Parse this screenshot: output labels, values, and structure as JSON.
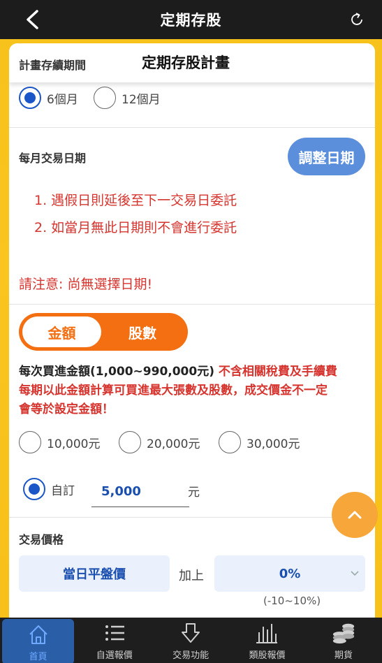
{
  "topbar": {
    "title": "定期存股"
  },
  "header": {
    "section_label": "計畫存續期間",
    "plan_title": "定期存股計畫"
  },
  "period": {
    "options": [
      "6個月",
      "12個月"
    ],
    "selected": "6個月"
  },
  "monthly": {
    "label": "每月交易日期",
    "adjust_button": "調整日期",
    "notes": [
      "1.  遇假日則延後至下一交易日委託",
      "2.  如當月無此日期則不會進行委託"
    ],
    "warning": "請注意: 尚無選擇日期!"
  },
  "toggle": {
    "amount": "金額",
    "shares": "股數",
    "active": "金額"
  },
  "amount_desc": {
    "line1_bold": "每次買進金額(1,000~990,000元)",
    "line1_red": " 不含相關稅費及手續費",
    "line2": "每期以此金額計算可買進最大張數及股數，成交價金不一定",
    "line3": "會等於設定金額！"
  },
  "amount_options": [
    "10,000元",
    "20,000元",
    "30,000元"
  ],
  "custom": {
    "label": "自訂",
    "value": "5,000",
    "unit": "元"
  },
  "price": {
    "label": "交易價格",
    "base": "當日平盤價",
    "plus_label": "加上",
    "offset": "0%",
    "range": "(-10~10%)"
  },
  "colors": {
    "accent_orange": "#f46e12",
    "brand_blue": "#1a56c8",
    "warning_red": "#d6342e",
    "background_yellow": "#f7c21b"
  },
  "bottomnav": [
    {
      "label": "首頁",
      "icon": "home-icon"
    },
    {
      "label": "自選報價",
      "icon": "list-icon"
    },
    {
      "label": "交易功能",
      "icon": "trade-icon"
    },
    {
      "label": "類股報價",
      "icon": "bar-chart-icon"
    },
    {
      "label": "期貨",
      "icon": "coins-icon"
    }
  ]
}
